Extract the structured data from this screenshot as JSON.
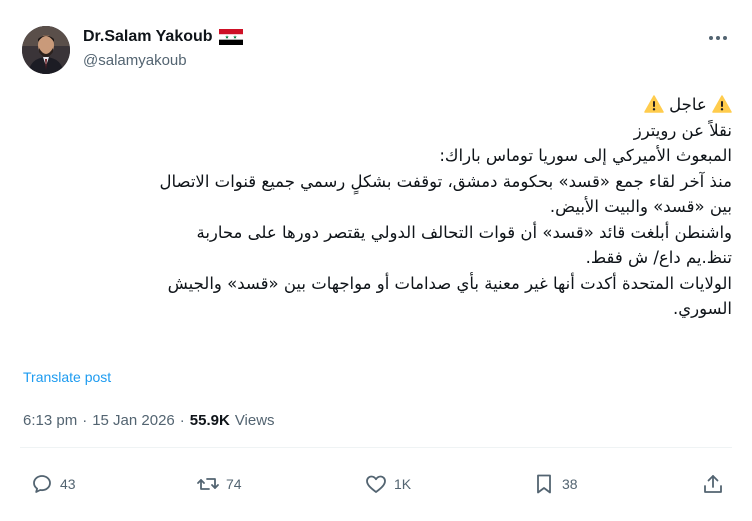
{
  "author": {
    "display_name": "Dr.Salam Yakoub",
    "handle": "@salamyakoub",
    "flag_icon": "flag-syria-icon"
  },
  "post": {
    "lines": [
      "عاجل",
      "نقلاً عن رويترز",
      "المبعوث الأميركي إلى سوريا توماس باراك:",
      "منذ آخر لقاء جمع «قسد» بحكومة دمشق، توقفت بشكلٍ رسمي جميع قنوات الاتصال",
      "بين «قسد» والبيت الأبيض.",
      "واشنطن أبلغت قائد «قسد» أن قوات التحالف الدولي يقتصر دورها على محاربة",
      "تنظ.يم داع/ ش فقط.",
      "الولايات المتحدة أكدت أنها غير معنية بأي صدامات أو مواجهات بين «قسد» والجيش",
      "السوري."
    ],
    "translate_label": "Translate post",
    "time": "6:13 pm",
    "date": "15 Jan 2026",
    "separator": "·",
    "views_count": "55.9K",
    "views_label": "Views"
  },
  "actions": {
    "reply_count": "43",
    "repost_count": "74",
    "like_count": "1K",
    "bookmark_count": "38"
  },
  "colors": {
    "link": "#1d9bf0",
    "secondary_text": "#536471",
    "primary_text": "#0f1419",
    "warning": "#ffcc4d"
  }
}
